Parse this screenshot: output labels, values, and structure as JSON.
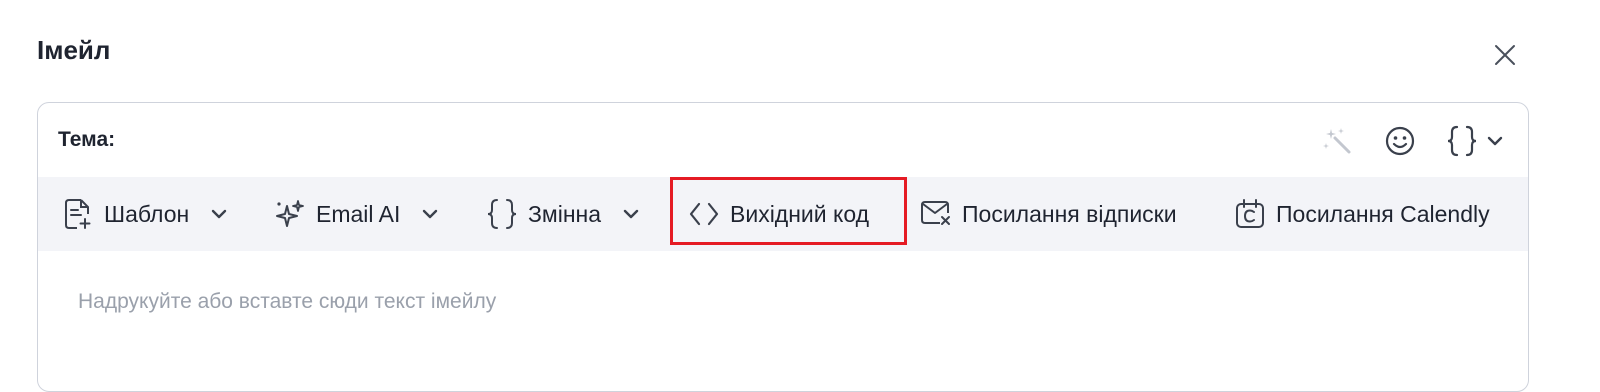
{
  "dialog": {
    "title": "Імейл"
  },
  "subject": {
    "label": "Тема:",
    "value": ""
  },
  "toolbar": {
    "template_label": "Шаблон",
    "ai_label": "Email AI",
    "variable_label": "Змінна",
    "source_code_label": "Вихідний код",
    "unsubscribe_label": "Посилання відписки",
    "calendly_label": "Посилання Calendly"
  },
  "editor": {
    "placeholder": "Надрукуйте або вставте сюди текст імейлу"
  },
  "icons": {
    "close": "close-icon",
    "magic": "magic-wand-icon",
    "emoji": "smiley-icon",
    "variable": "curly-braces-icon",
    "template": "document-plus-icon",
    "ai": "sparkles-icon",
    "source": "code-brackets-icon",
    "unsubscribe": "mail-x-icon",
    "calendly": "calendar-c-icon"
  },
  "colors": {
    "text": "#1f2430",
    "placeholder": "#9aa0ab",
    "toolbar_bg": "#f3f4f8",
    "border": "#cfd3dc",
    "highlight": "#e51b24"
  }
}
